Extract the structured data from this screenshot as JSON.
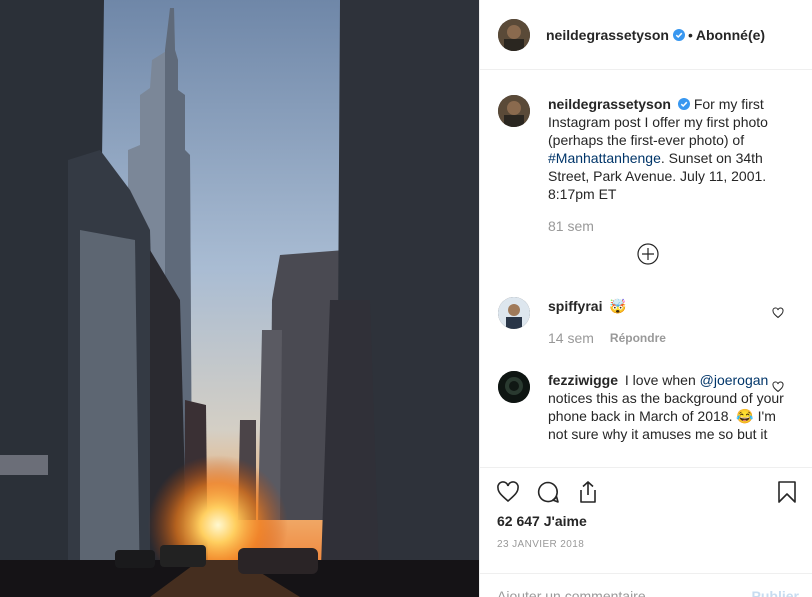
{
  "post": {
    "author": "neildegrassetyson",
    "follow_status": "Abonné(e)",
    "separator": "•",
    "caption": {
      "before": "For my first Instagram post I offer my first photo (perhaps the first-ever photo) of ",
      "hashtag": "#Manhattanhenge",
      "after": ". Sunset on 34th Street, Park Avenue. July 11, 2001. 8:17pm ET",
      "age": "81 sem"
    },
    "load_more_icon": "plus-circle-icon",
    "likes": "62 647 J'aime",
    "date": "23 JANVIER 2018"
  },
  "comments": [
    {
      "user": "spiffyrai",
      "text": "🤯",
      "age": "14 sem",
      "reply": "Répondre"
    },
    {
      "user": "fezziwigge",
      "text_before": "I love when ",
      "mention": "@joerogan",
      "text_after": " notices this as the background of your phone back in March of 2018. 😂 I'm not sure why it amuses me so but it"
    }
  ],
  "add_comment": {
    "placeholder": "Ajouter un commentaire...",
    "publish": "Publier"
  },
  "colors": {
    "accent": "#3897f0",
    "link": "#003569",
    "muted": "#999999",
    "border": "#efefef"
  }
}
